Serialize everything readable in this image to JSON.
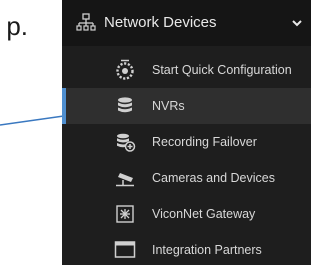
{
  "stray_text": "p.",
  "menu": {
    "header": {
      "label": "Network Devices"
    },
    "items": [
      {
        "label": "Start Quick Configuration",
        "active": false
      },
      {
        "label": "NVRs",
        "active": true
      },
      {
        "label": "Recording Failover",
        "active": false
      },
      {
        "label": "Cameras and Devices",
        "active": false
      },
      {
        "label": "ViconNet Gateway",
        "active": false
      },
      {
        "label": "Integration Partners",
        "active": false
      }
    ]
  },
  "colors": {
    "panel_bg": "#1e1e1e",
    "header_bg": "#151515",
    "active_bg": "#2f2f2f",
    "accent": "#4f8fd0",
    "arrow": "#3a78c0"
  },
  "icons": {
    "header": "network-tree-icon",
    "chevron": "chevron-down-icon",
    "items": [
      "gear-icon",
      "database-icon",
      "failover-database-icon",
      "security-camera-icon",
      "gateway-icon",
      "window-icon"
    ]
  }
}
